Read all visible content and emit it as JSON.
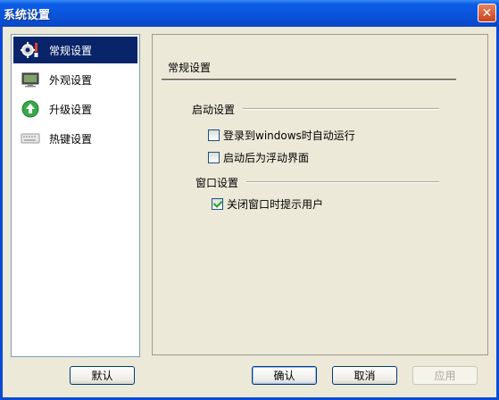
{
  "window": {
    "title": "系统设置",
    "close_glyph": "✕"
  },
  "sidebar": {
    "items": [
      {
        "label": "常规设置",
        "icon": "gear-wrench-icon",
        "active": true
      },
      {
        "label": "外观设置",
        "icon": "monitor-icon",
        "active": false
      },
      {
        "label": "升级设置",
        "icon": "upgrade-arrow-icon",
        "active": false
      },
      {
        "label": "热键设置",
        "icon": "keyboard-icon",
        "active": false
      }
    ]
  },
  "panel": {
    "title": "常规设置",
    "startup_group": {
      "label": "启动设置",
      "options": [
        {
          "label": "登录到windows时自动运行",
          "checked": false
        },
        {
          "label": "启动后为浮动界面",
          "checked": false
        }
      ]
    },
    "window_group": {
      "label": "窗口设置",
      "options": [
        {
          "label": "关闭窗口时提示用户",
          "checked": true
        }
      ]
    }
  },
  "buttons": {
    "default": "默认",
    "ok": "确认",
    "cancel": "取消",
    "apply": "应用"
  },
  "colors": {
    "titlebar": "#0a53d9",
    "selection": "#0a246a",
    "dialog_bg": "#ece9d8",
    "check_mark": "#21a121"
  }
}
